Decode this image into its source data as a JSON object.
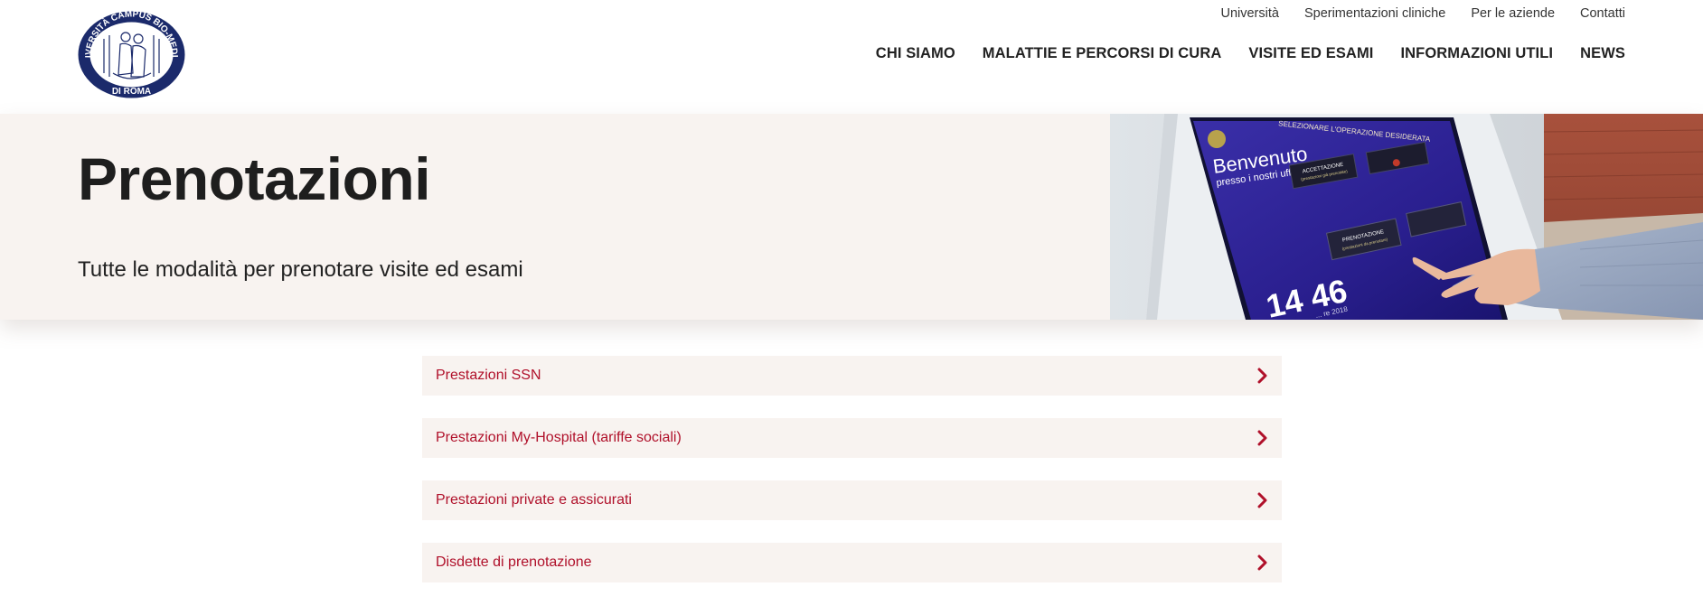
{
  "header": {
    "logo": {
      "text_top": "UNIVERSITÀ CAMPUS BIO-MEDICO",
      "text_bottom": "DI ROMA"
    },
    "utility_nav": [
      "Università",
      "Sperimentazioni cliniche",
      "Per le aziende",
      "Contatti"
    ],
    "main_nav": [
      "CHI SIAMO",
      "MALATTIE E PERCORSI DI CURA",
      "VISITE ED ESAMI",
      "INFORMAZIONI UTILI",
      "NEWS"
    ]
  },
  "hero": {
    "title": "Prenotazioni",
    "subtitle": "Tutte le modalità per prenotare visite ed esami",
    "kiosk_screen": {
      "header": "SELEZIONARE L'OPERAZIONE DESIDERATA",
      "welcome": "Benvenuto",
      "welcome_sub": "presso i nostri uffici",
      "button_accettazione": "ACCETTAZIONE",
      "button_accettazione_sub": "(prestazioni già prenotate)",
      "button_prenotazione": "PRENOTAZIONE",
      "button_prenotazione_sub": "(prestazioni da prenotare)",
      "time": "14 46",
      "date": "... re 2018"
    }
  },
  "links": [
    {
      "label": "Prestazioni SSN"
    },
    {
      "label": "Prestazioni My-Hospital (tariffe sociali)"
    },
    {
      "label": "Prestazioni private e assicurati"
    },
    {
      "label": "Disdette di prenotazione"
    }
  ],
  "colors": {
    "accent": "#b0102a",
    "hero_bg": "#f8f3f0",
    "logo_blue": "#1b2a6b"
  }
}
